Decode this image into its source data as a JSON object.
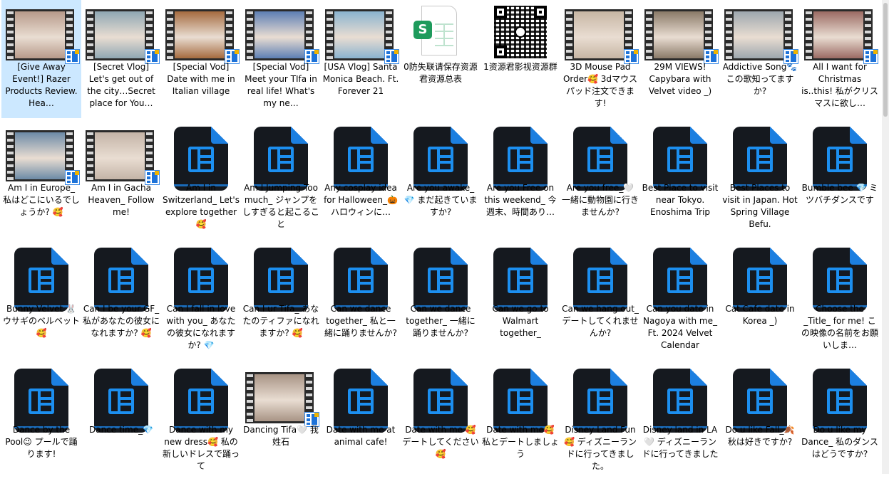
{
  "files": [
    {
      "label": "[Give Away Event!] Razer Products Review. Hea…",
      "kind": "video-thumb",
      "photo": "#b79a8a",
      "selected": true
    },
    {
      "label": "[Secret Vlog] Let's get out of the city…Secret place for You…",
      "kind": "video-thumb",
      "photo": "#8fa7b3"
    },
    {
      "label": "[Special Vod] Date with me in Italian village",
      "kind": "video-thumb",
      "photo": "#a56b3f"
    },
    {
      "label": "[Special Vod] Meet your TIfa in real life! What's my ne…",
      "kind": "video-thumb",
      "photo": "#5d7fb4"
    },
    {
      "label": "[USA Vlog] Santa Monica Beach. Ft. Forever 21",
      "kind": "video-thumb",
      "photo": "#8ab3cf"
    },
    {
      "label": "0防失联请保存资源君资源总表",
      "kind": "spreadsheet"
    },
    {
      "label": "1资源君影视资源群",
      "kind": "qr"
    },
    {
      "label": "3D Mouse Pad Order🥰 3dマウスパッド注文できます!",
      "kind": "video-thumb",
      "photo": "#c7b6a4"
    },
    {
      "label": "29M VIEWS! Capybara with Velvet video _)",
      "kind": "video-thumb",
      "photo": "#8a7a68"
    },
    {
      "label": "Addictive Song🐾この歌知ってますか?",
      "kind": "video-thumb",
      "photo": "#9da7ae"
    },
    {
      "label": "All I want for Christmas is..this! 私がクリスマスに欲し…",
      "kind": "video-thumb",
      "photo": "#9b6a63"
    },
    {
      "label": "Am I in Europe_ 私はどこにいるでしょうか? 🥰",
      "kind": "video-thumb",
      "photo": "#6c8aa6"
    },
    {
      "label": "Am I in Gacha Heaven_ Follow me!",
      "kind": "video-thumb",
      "photo": "#c4b4a7"
    },
    {
      "label": "Am I in Switzerland_ Let's explore together 🥰",
      "kind": "video-icon"
    },
    {
      "label": "Am I Jumping Too much_ ジャンプをしすぎると起こること",
      "kind": "video-icon"
    },
    {
      "label": "Any cosplay idea for Halloween_🎃 ハロウィンに…",
      "kind": "video-icon"
    },
    {
      "label": "Are you awake_💎 まだ起きていますか?",
      "kind": "video-icon"
    },
    {
      "label": "Are you Free on this weekend_ 今週末、時間あり…",
      "kind": "video-icon"
    },
    {
      "label": "Are you free_🤍 一緒に動物園に行きませんか?",
      "kind": "video-icon"
    },
    {
      "label": "Best Place to visit near Tokyo. Enoshima Trip",
      "kind": "video-icon"
    },
    {
      "label": "Best Places to visit in Japan. Hot Spring Village Befu.",
      "kind": "video-icon"
    },
    {
      "label": "Bumble bee 💎 ミツバチダンスです",
      "kind": "video-icon"
    },
    {
      "label": "Bunny Velvet 🐰 ウサギのベルベット🥰",
      "kind": "video-icon"
    },
    {
      "label": "Can I be your GF_ 私があなたの彼女になれますか? 🥰",
      "kind": "video-icon"
    },
    {
      "label": "Can I fall in love with you_ あなたの彼女になれますか? 💎",
      "kind": "video-icon"
    },
    {
      "label": "Can I ur Tifa_ あなたのティファになれますか? 🥰",
      "kind": "video-icon"
    },
    {
      "label": "Can we dance together_ 私と一緒に踊りませんか?",
      "kind": "video-icon"
    },
    {
      "label": "Can we dance together_ 一緒に踊りませんか?",
      "kind": "video-icon"
    },
    {
      "label": "Can we go to Walmart together_",
      "kind": "video-icon"
    },
    {
      "label": "Can we hang out_ デートしてくれませんか?",
      "kind": "video-icon"
    },
    {
      "label": "Can you date in Nagoya with me_ Ft. 2024 Velvet Calendar",
      "kind": "video-icon"
    },
    {
      "label": "Cat Cafe date in Korea _)",
      "kind": "video-icon"
    },
    {
      "label": "Choose the _Title_ for me! この映像の名前をお願いしま…",
      "kind": "video-icon"
    },
    {
      "label": "Dance by the Pool😉 プールで踊ります!",
      "kind": "video-icon"
    },
    {
      "label": "Dance time_💎",
      "kind": "video-icon"
    },
    {
      "label": "Dance with my new dress🥰 私の新しいドレスで踊って",
      "kind": "video-icon"
    },
    {
      "label": "Dancing Tifa🤍 我姓石",
      "kind": "video-thumb",
      "photo": "#a89485"
    },
    {
      "label": "Date with me at animal cafe!",
      "kind": "video-icon"
    },
    {
      "label": "Date with me 🥰 デートしてください🥰",
      "kind": "video-icon"
    },
    {
      "label": "Date with me🥰 私とデートしましょう",
      "kind": "video-icon"
    },
    {
      "label": "Disney Land Fun🥰 ディズニーランドに行ってきました。",
      "kind": "video-icon"
    },
    {
      "label": "Disney land in LA🤍 ディズニーランドに行ってきました",
      "kind": "video-icon"
    },
    {
      "label": "Do u like Fall_🍂秋は好きですか?",
      "kind": "video-icon"
    },
    {
      "label": "Do u like my Dance_ 私のダンスはどうですか?",
      "kind": "video-icon"
    }
  ]
}
